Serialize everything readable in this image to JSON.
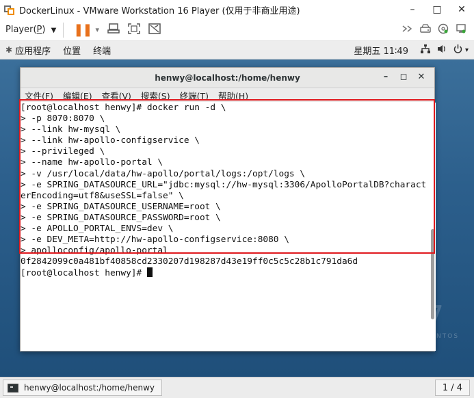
{
  "vmware": {
    "title": "DockerLinux - VMware Workstation 16 Player (仅用于非商业用途)",
    "window_buttons": {
      "minimize": "–",
      "maximize": "□",
      "close": "✕"
    },
    "toolbar": {
      "player_prefix": "Player(",
      "player_key": "P",
      "player_suffix": ")",
      "player_arrow": "▼",
      "pause_glyph": "❚❚",
      "pause_arrow": "▾"
    }
  },
  "gnome": {
    "menu_apps": "应用程序",
    "menu_places": "位置",
    "menu_terminal": "终端",
    "clock": "星期五 11∶49",
    "network_glyph": "品",
    "volume_glyph": "◀)",
    "power_glyph": "⏻",
    "menu_arrow": "▾"
  },
  "desktop": {
    "watermark_num": "7",
    "watermark_text": "NTOS"
  },
  "terminal": {
    "title": "henwy@localhost:/home/henwy",
    "controls": {
      "minimize": "–",
      "maximize": "◻",
      "close": "✕"
    },
    "menu": [
      "文件(F)",
      "编辑(E)",
      "查看(V)",
      "搜索(S)",
      "终端(T)",
      "帮助(H)"
    ],
    "lines": [
      "[root@localhost henwy]# docker run -d \\",
      "> -p 8070:8070 \\",
      "> --link hw-mysql \\",
      "> --link hw-apollo-configservice \\",
      "> --privileged \\",
      "> --name hw-apollo-portal \\",
      "> -v /usr/local/data/hw-apollo/portal/logs:/opt/logs \\",
      "> -e SPRING_DATASOURCE_URL=\"jdbc:mysql://hw-mysql:3306/ApolloPortalDB?charact",
      "erEncoding=utf8&useSSL=false\" \\",
      "> -e SPRING_DATASOURCE_USERNAME=root \\",
      "> -e SPRING_DATASOURCE_PASSWORD=root \\",
      "> -e APOLLO_PORTAL_ENVS=dev \\",
      "> -e DEV_META=http://hw-apollo-configservice:8080 \\",
      "> apolloconfig/apollo-portal",
      "0f2842099c0a481bf40858cd2330207d198287d43e19ff0c5c5c28b1c791da6d"
    ],
    "prompt": "[root@localhost henwy]# "
  },
  "taskbar": {
    "task_label": "henwy@localhost:/home/henwy",
    "workspace": "1 / 4"
  },
  "colors": {
    "highlight": "#e0191e",
    "pause": "#e8711c"
  }
}
